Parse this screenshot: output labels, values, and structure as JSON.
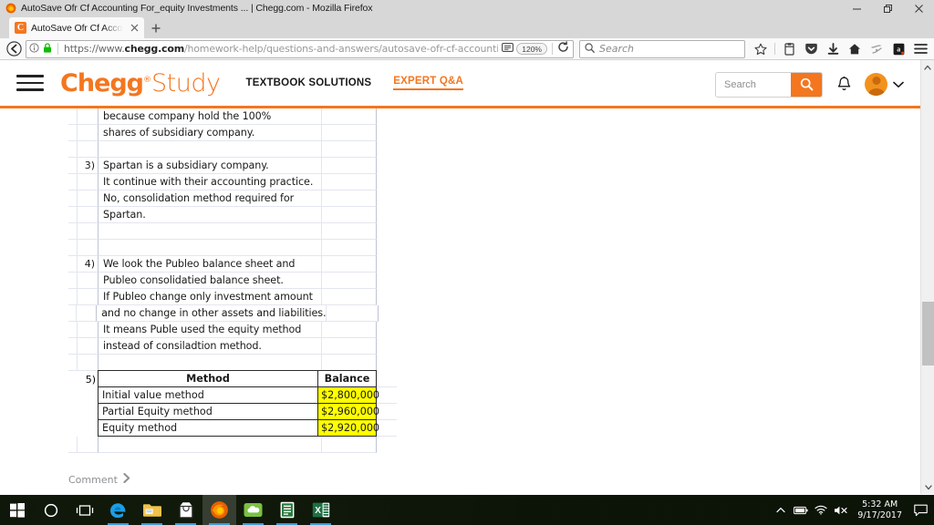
{
  "window": {
    "title": "AutoSave Ofr Cf Accounting For_equity Investments ... | Chegg.com - Mozilla Firefox",
    "minimize_label": "Minimize",
    "restore_label": "Restore",
    "close_label": "Close"
  },
  "browser": {
    "tab": {
      "title": "AutoSave Ofr Cf Accounting",
      "favicon_letter": "C",
      "close_label": "Close tab"
    },
    "new_tab_label": "+",
    "url": {
      "scheme": "https://www.",
      "domain": "chegg.com",
      "path": "/homework-help/questions-and-answers/autosave-ofr-cf-accounting-fore"
    },
    "zoom_level": "120%",
    "search_placeholder": "Search",
    "icons": {
      "back": "back-arrow-icon",
      "info": "page-info-icon",
      "lock": "padlock-icon",
      "reader": "reader-view-icon",
      "reload": "reload-icon",
      "search": "search-icon",
      "bookmark": "star-icon",
      "library": "library-icon",
      "pocket": "pocket-icon",
      "downloads": "downloads-icon",
      "home": "home-icon",
      "sync": "sync-icon",
      "amazon": "amazon-icon",
      "menu": "hamburger-menu-icon"
    }
  },
  "site": {
    "brand_primary": "Chegg",
    "brand_registered": "®",
    "brand_secondary": "Study",
    "nav": [
      {
        "label": "TEXTBOOK SOLUTIONS",
        "active": false
      },
      {
        "label": "EXPERT Q&A",
        "active": true
      }
    ],
    "search_placeholder": "Search",
    "accent_color": "#f4761f"
  },
  "answer": {
    "lines": [
      {
        "num": "",
        "text": "because company hold the 100%"
      },
      {
        "num": "",
        "text": "shares of subsidiary company."
      },
      {
        "num": "",
        "text": ""
      },
      {
        "num": "3)",
        "text": "Spartan is a subsidiary company."
      },
      {
        "num": "",
        "text": "It continue with their accounting practice."
      },
      {
        "num": "",
        "text": "No, consolidation method required for"
      },
      {
        "num": "",
        "text": "Spartan."
      },
      {
        "num": "",
        "text": ""
      },
      {
        "num": "",
        "text": ""
      },
      {
        "num": "4)",
        "text": "We look the Publeo balance sheet and"
      },
      {
        "num": "",
        "text": "Publeo consolidatied balance sheet."
      },
      {
        "num": "",
        "text": "If Publeo change only investment amount"
      },
      {
        "num": "",
        "text": "and no change in other assets and liabilities."
      },
      {
        "num": "",
        "text": "It means Puble used the equity method"
      },
      {
        "num": "",
        "text": "instead of consiladtion method."
      },
      {
        "num": "",
        "text": ""
      }
    ],
    "table": {
      "num": "5)",
      "columns": [
        "Method",
        "Balance"
      ],
      "rows": [
        {
          "method": "Initial value method",
          "balance": "$2,800,000"
        },
        {
          "method": "Partial Equity method",
          "balance": "$2,960,000"
        },
        {
          "method": "Equity method",
          "balance": "$2,920,000"
        }
      ],
      "highlight_color": "#ffff00"
    },
    "comment_label": "Comment"
  },
  "taskbar": {
    "items": [
      {
        "name": "start-button",
        "label": "Start"
      },
      {
        "name": "cortana-button",
        "label": "Cortana"
      },
      {
        "name": "task-view-button",
        "label": "Task View"
      },
      {
        "name": "taskbar-edge",
        "label": "Microsoft Edge"
      },
      {
        "name": "taskbar-file-explorer",
        "label": "File Explorer"
      },
      {
        "name": "taskbar-store",
        "label": "Microsoft Store"
      },
      {
        "name": "taskbar-firefox",
        "label": "Mozilla Firefox"
      },
      {
        "name": "taskbar-onedrive-app",
        "label": "Cloud App"
      },
      {
        "name": "taskbar-onenote",
        "label": "OneNote"
      },
      {
        "name": "taskbar-excel",
        "label": "Microsoft Excel"
      }
    ],
    "tray": {
      "show_hidden": "show-hidden-icons",
      "battery": "battery-icon",
      "network": "wifi-icon",
      "volume": "volume-muted-icon",
      "time": "5:32 AM",
      "date": "9/17/2017",
      "action_center": "action-center-icon"
    }
  }
}
